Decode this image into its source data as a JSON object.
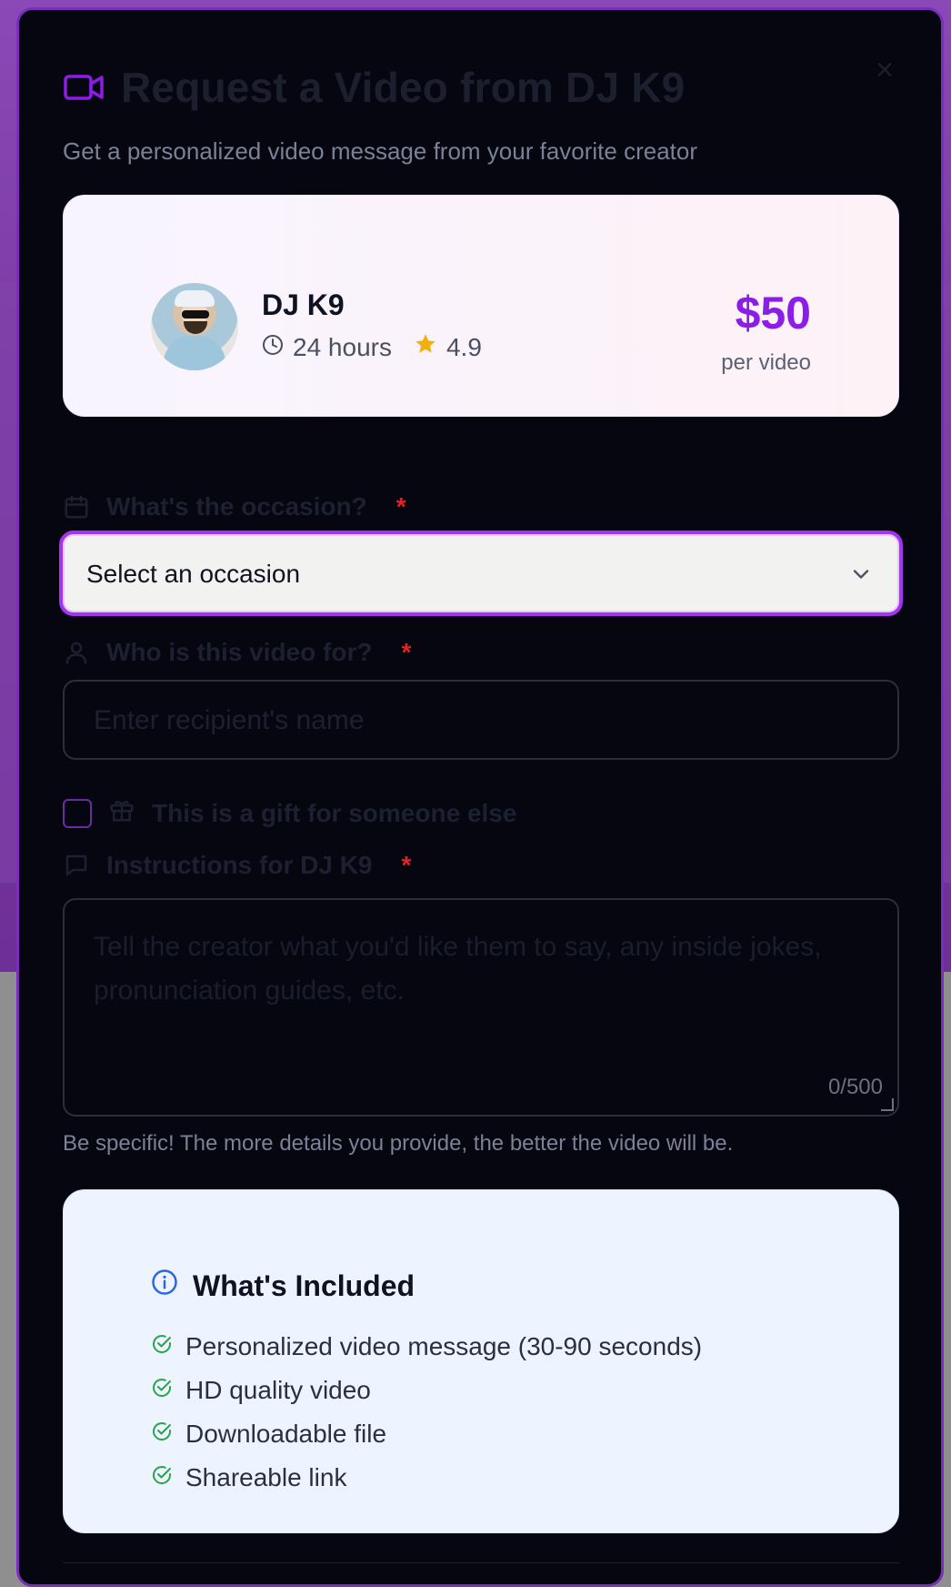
{
  "modal": {
    "title": "Request a Video from DJ K9",
    "subtitle": "Get a personalized video message from your favorite creator",
    "close_label": "×"
  },
  "creator": {
    "name": "DJ K9",
    "turnaround": "24 hours",
    "rating": "4.9",
    "price": "$50",
    "price_unit": "per video"
  },
  "form": {
    "occasion": {
      "label": "What's the occasion?",
      "required_mark": "*",
      "selected_value": "Select an occasion"
    },
    "recipient": {
      "label": "Who is this video for?",
      "required_mark": "*",
      "placeholder": "Enter recipient's name"
    },
    "gift": {
      "label": "This is a gift for someone else",
      "checked": false
    },
    "instructions": {
      "label": "Instructions for DJ K9",
      "required_mark": "*",
      "placeholder": "Tell the creator what you'd like them to say, any inside jokes, pronunciation guides, etc.",
      "counter": "0/500",
      "hint": "Be specific! The more details you provide, the better the video will be."
    }
  },
  "included": {
    "title": "What's Included",
    "items": [
      "Personalized video message (30-90 seconds)",
      "HD quality video",
      "Downloadable file",
      "Shareable link"
    ]
  },
  "colors": {
    "accent": "#8b1de6",
    "required": "#e02424",
    "check": "#22a845",
    "info": "#2f66e0",
    "star": "#f2b10a"
  },
  "icons": {
    "title": "video-camera-icon",
    "close": "close-icon",
    "turnaround": "clock-icon",
    "rating": "star-icon",
    "occasion": "calendar-icon",
    "select": "chevron-down-icon",
    "recipient": "user-icon",
    "gift": "gift-icon",
    "instructions": "message-icon",
    "included": "info-icon",
    "included_item": "check-circle-icon"
  }
}
